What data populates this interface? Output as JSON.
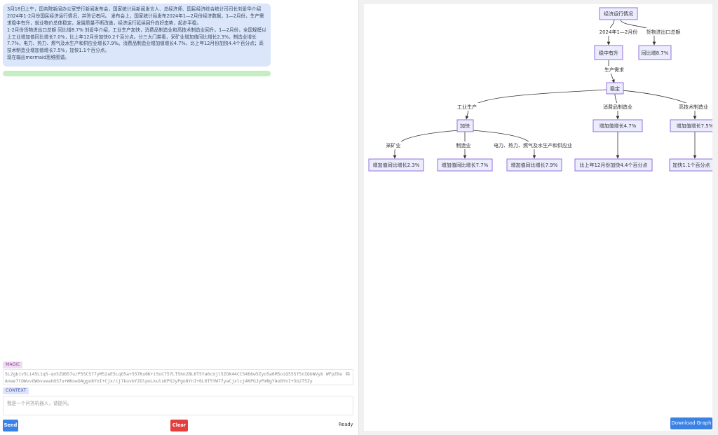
{
  "chat": {
    "paragraphs": [
      "3月18日上午，国务院新闻办公室举行新闻发布会，国家统计局新闻发言人、总经济师、国民经济综合统计司司长刘爱华介绍2024年1-2月份国民经济运行情况，并答记者问。 发布会上，国家统计局发布2024年1—2月份经济数据，1—2月份，生产需求稳中有升，就业物价总体稳定，发展质量不断改善，经济运行延续回升向好态势，起步平稳。",
      "1-2月份货物进出口总额 同比增8.7% 刘爱华介绍，工业生产加快，消费品制造业和高技术制造业回升。1—2月份，全国规模以上工业增加值同比增长7.0%，比上年12月份加快0.2个百分点。分三大门类看，采矿业增加值同比增长2.3%，制造业增长7.7%，电力、热力、燃气及水生产和供应业增长7.9%。消费品制造业增加值增长4.7%，比上年12月份加快4.4个百分点；高技术制造业增加值增长7.5%，加快1.1个百分点。",
      "现在输出mermaid思维图谱。"
    ]
  },
  "progress": {
    "fraction": 1.0
  },
  "magic": {
    "label": "MAGIC",
    "value": "5L2gbiv5Li45L1q5-qn5ZOB57u/P5SCS77yM52aE5LqO5a+557Ku6K+i5oC757LTShn2BL6T5Ya6cdjl5ZOK44CC5466w5Zyo5a6M5oiQ555f5nIQbWVyb WFpZ0aAnee7tOWvvOWbvueahOS7u+WKoeOAggo8YnI+Cjx/cj7kuvbYZOlpoLkulsKPGJyPgo8YnI+6L6T5YW77yaCjxlcj4KPGJyPmBgYAo8YnI+5b2T5Zy",
    "copy_icon": "copy-icon"
  },
  "context": {
    "label": "CONTEXT",
    "placeholder": "我是一个问答机器人，请提问。"
  },
  "buttons": {
    "send": "Send",
    "clear": "Clear",
    "download": "Download Graph"
  },
  "status": "Ready",
  "graph": {
    "nodes": {
      "root": "经济运行情况",
      "n1": "稳中有升",
      "n2": "同比增8.7%",
      "n3": "稳定",
      "n4": "加快",
      "n5": "增加值增长4.7%",
      "n6": "增加值增长7.5%",
      "n7": "增加值同比增长2.3%",
      "n8": "增加值同比增长7.7%",
      "n9": "增加值同比增长7.9%",
      "n10": "比上年12月份加快4.4个百分点",
      "n11": "加快1.1个百分点"
    },
    "edge_labels": {
      "e_root_n1": "2024年1—2月份",
      "e_root_n2": "货物进出口总额",
      "e_n1_n3": "生产需求",
      "e_n3_n4": "工业生产",
      "e_n3_n5": "消费品制造业",
      "e_n3_n6": "高技术制造业",
      "e_n4_n7": "采矿业",
      "e_n4_n8": "制造业",
      "e_n4_n9": "电力、热力、燃气及水生产和供应业"
    }
  }
}
